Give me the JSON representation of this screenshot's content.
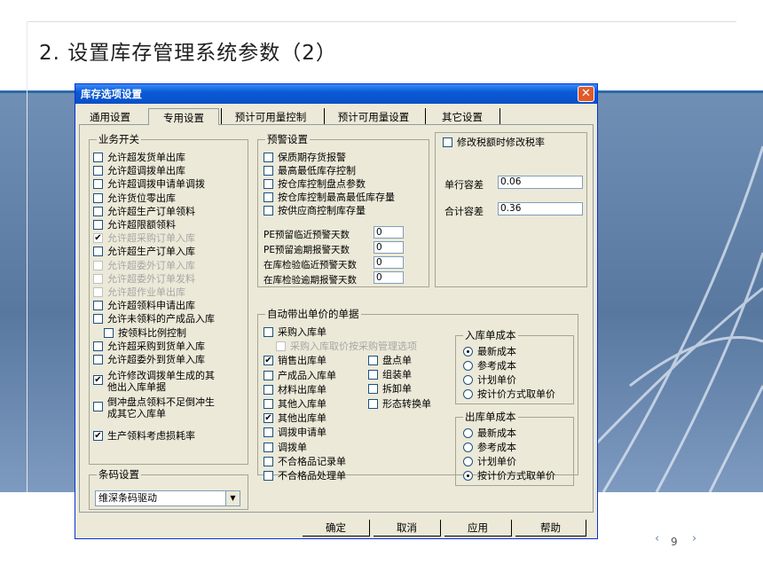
{
  "slide": {
    "title": "2. 设置库存管理系统参数（2）",
    "page_number": "9",
    "prev": "‹",
    "next": "›"
  },
  "window": {
    "title": "库存选项设置",
    "close": "✕"
  },
  "tabs": [
    "通用设置",
    "专用设置",
    "预计可用量控制",
    "预计可用量设置",
    "其它设置"
  ],
  "business": {
    "legend": "业务开关",
    "items": [
      {
        "label": "允许超发货单出库",
        "checked": false,
        "disabled": false
      },
      {
        "label": "允许超调拨单出库",
        "checked": false,
        "disabled": false
      },
      {
        "label": "允许超调拨申请单调拨",
        "checked": false,
        "disabled": false
      },
      {
        "label": "允许货位零出库",
        "checked": false,
        "disabled": false
      },
      {
        "label": "允许超生产订单领料",
        "checked": false,
        "disabled": false
      },
      {
        "label": "允许超限额领料",
        "checked": false,
        "disabled": false
      },
      {
        "label": "允许超采购订单入库",
        "checked": true,
        "disabled": true
      },
      {
        "label": "允许超生产订单入库",
        "checked": false,
        "disabled": false
      },
      {
        "label": "允许超委外订单入库",
        "checked": false,
        "disabled": true
      },
      {
        "label": "允许超委外订单发料",
        "checked": false,
        "disabled": true
      },
      {
        "label": "允许超作业单出库",
        "checked": false,
        "disabled": true
      },
      {
        "label": "允许超领料申请出库",
        "checked": false,
        "disabled": false
      },
      {
        "label": "允许未领料的产成品入库",
        "checked": false,
        "disabled": false
      },
      {
        "label": "按领料比例控制",
        "checked": false,
        "disabled": false
      },
      {
        "label": "允许超采购到货单入库",
        "checked": false,
        "disabled": false
      },
      {
        "label": "允许超委外到货单入库",
        "checked": false,
        "disabled": false
      }
    ],
    "extra1_l1": "允许修改调拨单生成的其",
    "extra1_l2": "他出入库单据",
    "extra2_l1": "倒冲盘点领料不足倒冲生",
    "extra2_l2": "成其它入库单",
    "extra3": "生产领料考虑损耗率"
  },
  "warning": {
    "legend": "预警设置",
    "items": [
      "保质期存货报警",
      "最高最低库存控制",
      "按仓库控制盘点参数",
      "按仓库控制最高最低库存量",
      "按供应商控制库存量"
    ],
    "days": [
      {
        "label": "PE预留临近预警天数",
        "value": "0"
      },
      {
        "label": "PE预留逾期报警天数",
        "value": "0"
      },
      {
        "label": "在库检验临近预警天数",
        "value": "0"
      },
      {
        "label": "在库检验逾期报警天数",
        "value": "0"
      }
    ]
  },
  "tax": {
    "label": "修改税额时修改税率",
    "unit_diff_label": "单行容差",
    "unit_diff": "0.06",
    "total_diff_label": "合计容差",
    "total_diff": "0.36"
  },
  "auto_price": {
    "legend": "自动带出单价的单据",
    "col1": [
      {
        "label": "采购入库单",
        "checked": false,
        "disabled": false
      },
      {
        "label": "采购入库取价按采购管理选项",
        "checked": false,
        "disabled": true
      },
      {
        "label": "销售出库单",
        "checked": true,
        "disabled": false
      },
      {
        "label": "产成品入库单",
        "checked": false,
        "disabled": false
      },
      {
        "label": "材料出库单",
        "checked": false,
        "disabled": false
      },
      {
        "label": "其他入库单",
        "checked": false,
        "disabled": false
      },
      {
        "label": "其他出库单",
        "checked": true,
        "disabled": false
      },
      {
        "label": "调拨申请单",
        "checked": false,
        "disabled": false
      },
      {
        "label": "调拨单",
        "checked": false,
        "disabled": false
      },
      {
        "label": "不合格品记录单",
        "checked": false,
        "disabled": false
      },
      {
        "label": "不合格品处理单",
        "checked": false,
        "disabled": false
      }
    ],
    "col2": [
      "盘点单",
      "组装单",
      "拆卸单",
      "形态转换单"
    ]
  },
  "in_cost": {
    "legend": "入库单成本",
    "options": [
      "最新成本",
      "参考成本",
      "计划单价",
      "按计价方式取单价"
    ],
    "selected": 0
  },
  "out_cost": {
    "legend": "出库单成本",
    "options": [
      "最新成本",
      "参考成本",
      "计划单价",
      "按计价方式取单价"
    ],
    "selected": 3
  },
  "barcode": {
    "legend": "条码设置",
    "value": "维深条码驱动",
    "arrow": "▼"
  },
  "buttons": [
    "确定",
    "取消",
    "应用",
    "帮助"
  ]
}
